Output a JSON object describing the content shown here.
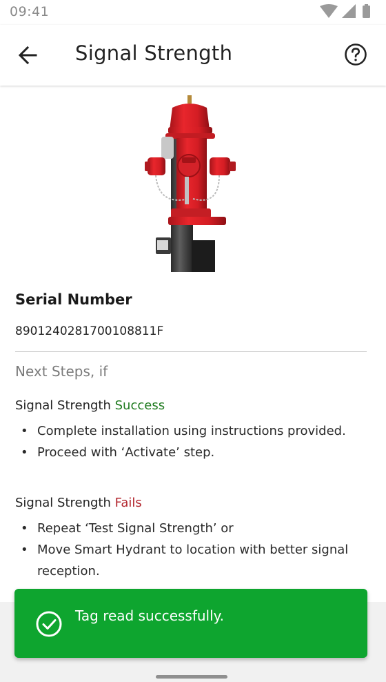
{
  "status_bar": {
    "time": "09:41",
    "icons": [
      "wifi-icon",
      "cellular-icon",
      "battery-icon"
    ]
  },
  "app_bar": {
    "title": "Signal Strength",
    "back_icon": "arrow-left-icon",
    "help_icon": "help-circle-icon"
  },
  "device": {
    "image": "fire-hydrant-image",
    "serial_label": "Serial Number",
    "serial_value": "8901240281700108811F"
  },
  "next_steps": {
    "heading": "Next Steps, if",
    "success": {
      "prefix": "Signal Strength",
      "status": "Success",
      "status_color": "#1e7a1e",
      "items": [
        "Complete installation using instructions provided.",
        "Proceed with ‘Activate’ step."
      ]
    },
    "fail": {
      "prefix": "Signal Strength",
      "status": "Fails",
      "status_color": "#b3262e",
      "items": [
        "Repeat ‘Test Signal Strength’ or",
        "Move Smart Hydrant to location with better signal reception."
      ]
    }
  },
  "toast": {
    "message": "Tag read successfully.",
    "icon": "check-circle-icon",
    "background": "#0ea52f"
  }
}
